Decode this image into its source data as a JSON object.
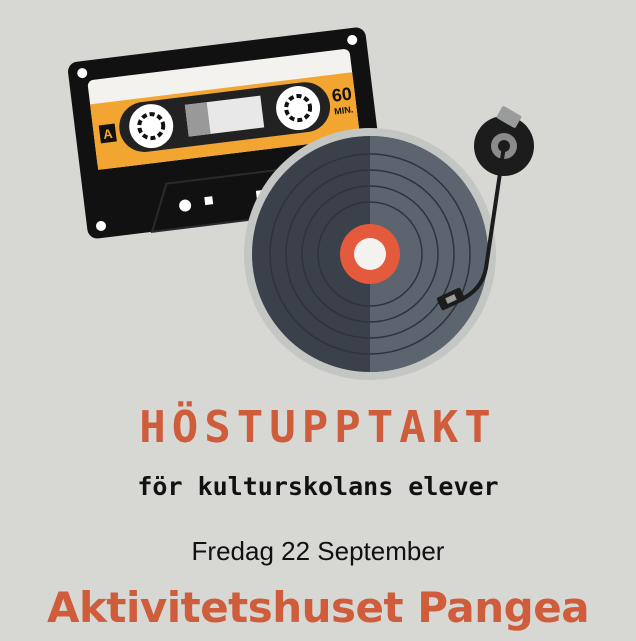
{
  "colors": {
    "background": "#d7d8d4",
    "accent": "#cf5c3a",
    "text": "#111111"
  },
  "illustration": {
    "cassette_label_letter": "A",
    "cassette_length_number": "60",
    "cassette_length_unit": "MIN.",
    "icons": [
      "cassette-tape-icon",
      "vinyl-record-icon",
      "tonearm-icon"
    ]
  },
  "poster": {
    "title": "HÖSTUPPTAKT",
    "subtitle": "för kulturskolans elever",
    "date": "Fredag 22 September",
    "venue": "Aktivitetshuset Pangea"
  }
}
